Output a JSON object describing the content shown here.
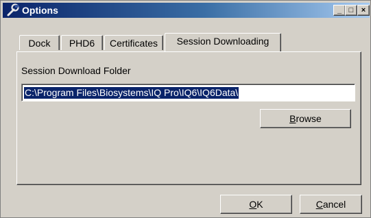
{
  "window": {
    "title": "Options",
    "icon": "wrench-icon",
    "controls": {
      "minimize": "_",
      "maximize": "□",
      "close": "×"
    }
  },
  "tabs": [
    {
      "label": "Dock",
      "active": false
    },
    {
      "label": "PHD6",
      "active": false
    },
    {
      "label": "Certificates",
      "active": false
    },
    {
      "label": "Session Downloading",
      "active": true
    }
  ],
  "session": {
    "folder_label": "Session Download Folder",
    "folder_value": "C:\\Program Files\\Biosystems\\IQ Pro\\IQ6\\IQ6Data\\",
    "browse_hotkey": "B",
    "browse_rest": "rowse"
  },
  "footer": {
    "ok_hotkey": "O",
    "ok_rest": "K",
    "cancel_hotkey": "C",
    "cancel_rest": "ancel"
  },
  "colors": {
    "titlebar_start": "#0a246a",
    "titlebar_end": "#a6caf0",
    "face": "#d4d0c8",
    "selection": "#0a246a"
  }
}
